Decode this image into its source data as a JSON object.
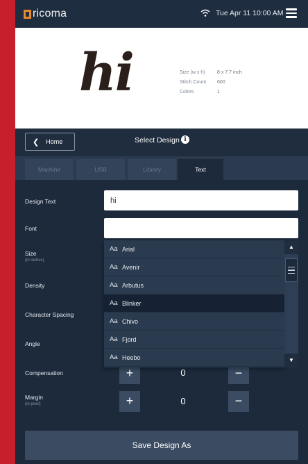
{
  "app": {
    "logo_text": "ricoma",
    "datetime": "Tue Apr 11  10:00 AM"
  },
  "preview": {
    "design_text": "hi",
    "specs": [
      {
        "label": "Size (w x h)",
        "value": "8 x 7.7 inch"
      },
      {
        "label": "Stitch Count",
        "value": "600"
      },
      {
        "label": "Colors",
        "value": "1"
      }
    ]
  },
  "nav": {
    "home_label": "Home",
    "title": "Select Design"
  },
  "tabs": [
    {
      "label": "Machine"
    },
    {
      "label": "USB"
    },
    {
      "label": "Library"
    },
    {
      "label": "Text"
    }
  ],
  "form": {
    "design_text_label": "Design Text",
    "design_text_value": "hi",
    "font_label": "Font",
    "font_value": "",
    "size_label": "Size",
    "size_sublabel": "(in inches)",
    "density_label": "Density",
    "char_spacing_label": "Character Spacing",
    "angle_label": "Angle",
    "compensation_label": "Compensation",
    "compensation_value": "0",
    "margin_label": "Margin",
    "margin_sublabel": "(in pixel)",
    "margin_value": "0",
    "plus": "+",
    "minus": "−"
  },
  "font_dropdown": {
    "sample": "Aa",
    "options": [
      "Arial",
      "Avenir",
      "Arbutus",
      "Blinker",
      "Chivo",
      "Fjord",
      "Heebo"
    ],
    "highlighted_index": 3
  },
  "save_label": "Save Design As",
  "colors": {
    "background": "#c8202a",
    "panel": "#1c2a3c",
    "logo_accent": "#e88a2a"
  }
}
